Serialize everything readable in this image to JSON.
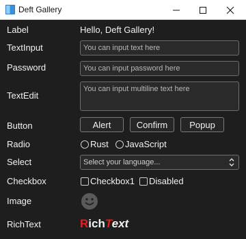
{
  "window": {
    "title": "Deft Gallery"
  },
  "labels": {
    "label": "Label",
    "textinput": "TextInput",
    "password": "Password",
    "textedit": "TextEdit",
    "button": "Button",
    "radio": "Radio",
    "select": "Select",
    "checkbox": "Checkbox",
    "image": "Image",
    "richtext": "RichText"
  },
  "label_value": "Hello, Deft Gallery!",
  "textinput": {
    "placeholder": "You can input text here",
    "value": ""
  },
  "password": {
    "placeholder": "You can input password here",
    "value": ""
  },
  "textedit": {
    "placeholder": "You can input multiline text here",
    "value": ""
  },
  "buttons": {
    "alert": "Alert",
    "confirm": "Confirm",
    "popup": "Popup"
  },
  "radios": [
    {
      "label": "Rust",
      "checked": false
    },
    {
      "label": "JavaScript",
      "checked": false
    }
  ],
  "select": {
    "placeholder": "Select your language...",
    "icon": "chevron-updown-icon"
  },
  "checkboxes": [
    {
      "label": "Checkbox1",
      "checked": false
    },
    {
      "label": "Disabled",
      "checked": false
    }
  ],
  "image": {
    "icon": "smiley-face-icon"
  },
  "richtext": {
    "part1": "R",
    "part2": "ich",
    "part3": "T",
    "part4": "ext"
  },
  "colors": {
    "background": "#1e1e1e",
    "accent_red": "#e02020",
    "border": "#6e6e6e"
  }
}
